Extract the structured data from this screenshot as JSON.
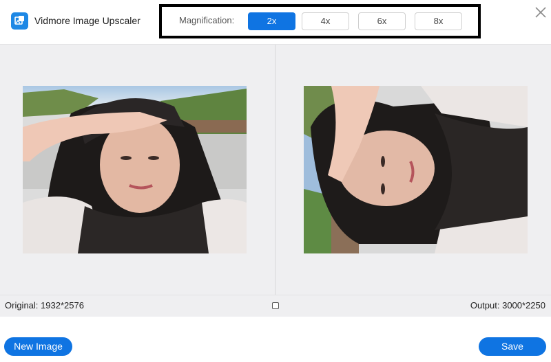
{
  "app": {
    "title": "Vidmore Image Upscaler",
    "logo_icon": "image-upscaler-logo-icon",
    "accent_color": "#0f74e2"
  },
  "magnification": {
    "label": "Magnification:",
    "options": [
      "2x",
      "4x",
      "6x",
      "8x"
    ],
    "selected": "2x"
  },
  "window": {
    "close_icon": "close-icon"
  },
  "preview": {
    "left_image_description_icon": "original-photo",
    "right_image_description_icon": "upscaled-photo"
  },
  "info": {
    "original": "Original: 1932*2576",
    "output": "Output: 3000*2250",
    "compare_icon": "split-compare-icon"
  },
  "actions": {
    "new_image": "New Image",
    "save": "Save"
  }
}
